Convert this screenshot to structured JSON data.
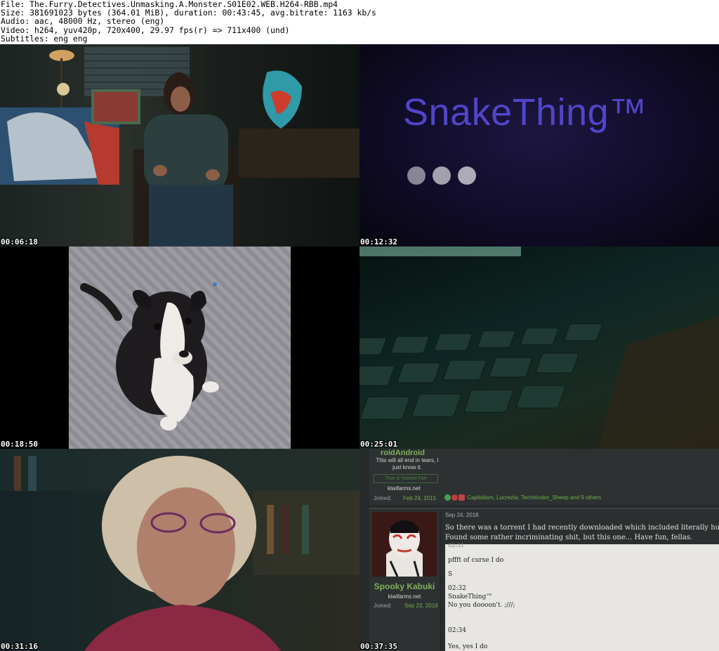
{
  "header": {
    "line1": "File: The.Furry.Detectives.Unmasking.A.Monster.S01E02.WEB.H264-RBB.mp4",
    "line2": "Size: 381691023 bytes (364.01 MiB), duration: 00:43:45, avg.bitrate: 1163 kb/s",
    "line3": "Audio: aac, 48000 Hz, stereo (eng)",
    "line4": "Video: h264, yuv420p, 720x400, 29.97 fps(r) => 711x400 (und)",
    "line5": "Subtitles: eng eng"
  },
  "frames": [
    {
      "timestamp": "00:06:18"
    },
    {
      "timestamp": "00:12:32",
      "title": "SnakeThing™"
    },
    {
      "timestamp": "00:18:50"
    },
    {
      "timestamp": "00:25:01"
    },
    {
      "timestamp": "00:31:16"
    },
    {
      "timestamp": "00:37:35"
    }
  ],
  "forum": {
    "top_user": "roidAndroid",
    "top_tagline": "This will all end in tears, I just know it.",
    "top_button": "True & Honest Fan",
    "top_site": "kiwifarms.net",
    "joined_label": "Joined:",
    "top_joined": "Feb 24, 2015",
    "reactions": "Capitalism, Lucrezia, Technicolor_Sheep and 9 others",
    "user": "Spooky Kabuki",
    "site": "kiwifarms.net",
    "joined": "Sep 23, 2018",
    "post_date": "Sep 24, 2018",
    "body_line1": "So there was a torrent I had recently downloaded which included literally hundre",
    "body_line2": "Found some rather incriminating shit, but this one... Have fun, fellas.",
    "chat": {
      "time0": "02:31",
      "msg0": "pffft of curse I do",
      "s": "S",
      "time1": "02:32",
      "sender1": "SnakeThing™",
      "msg1": "No you doooon't. ;///;",
      "time2": "02:34",
      "msg2": "Yes, yes I do"
    }
  }
}
